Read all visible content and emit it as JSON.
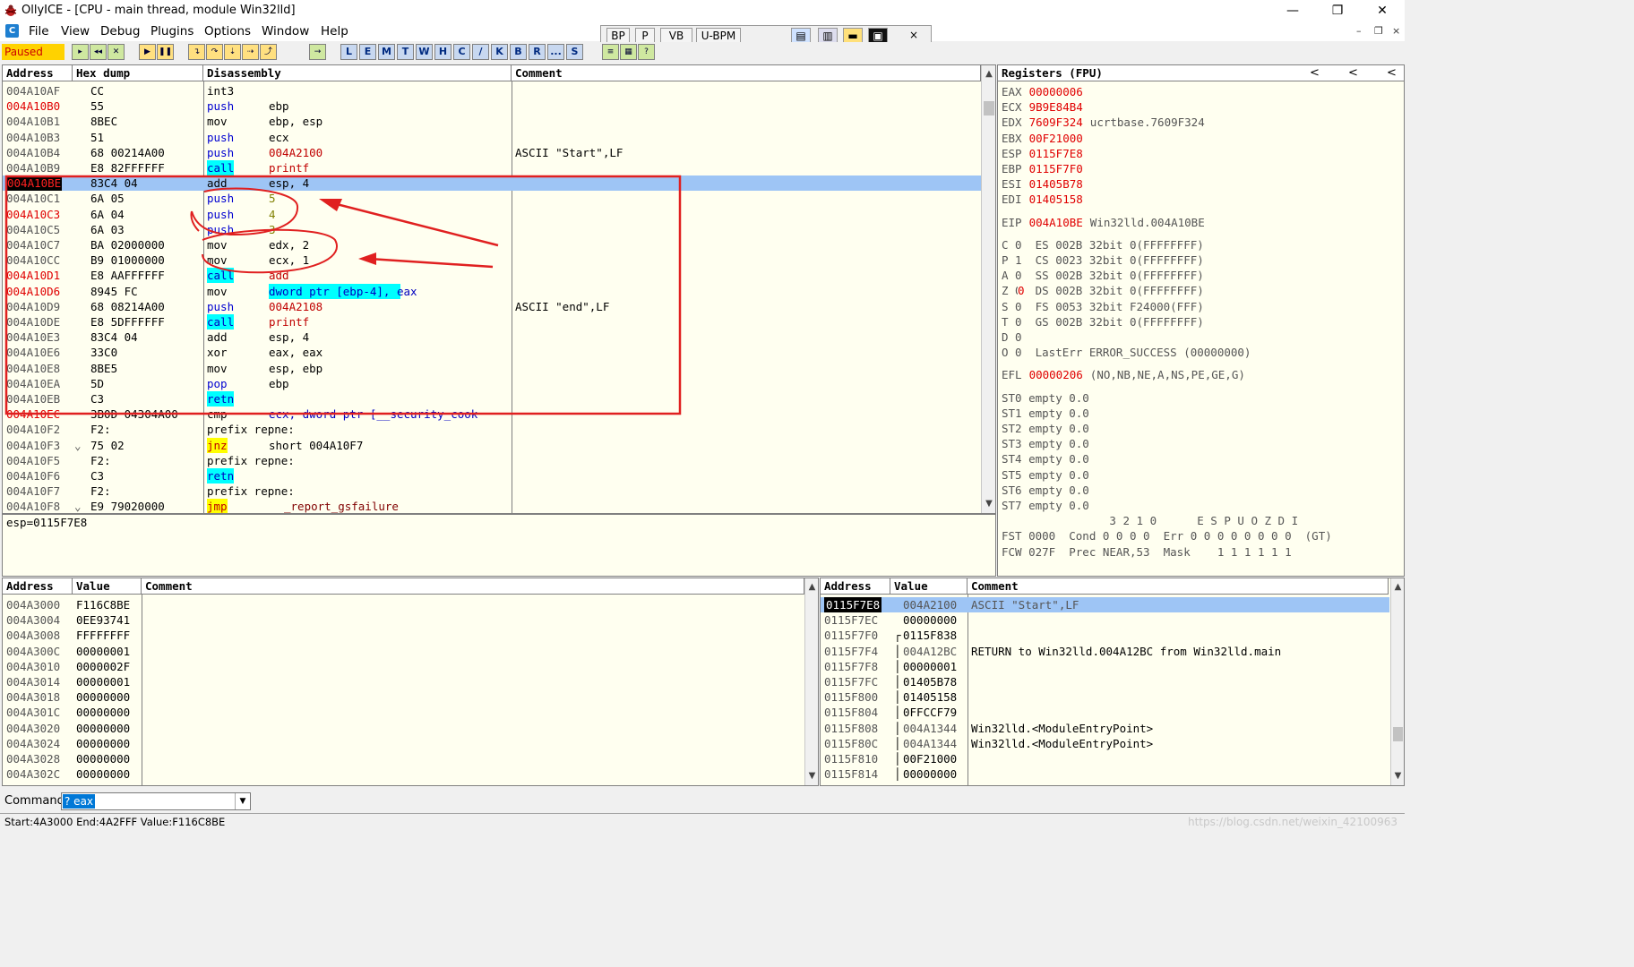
{
  "window": {
    "title": "OllyICE - [CPU - main thread, module Win32lld]",
    "minimize": "—",
    "restore": "❐",
    "close": "✕"
  },
  "menu": [
    "File",
    "View",
    "Debug",
    "Plugins",
    "Options",
    "Window",
    "Help"
  ],
  "mdi_controls": [
    "–",
    "❐",
    "×"
  ],
  "tb2": [
    "BP",
    "P",
    "VB",
    "U-BPM",
    "×"
  ],
  "toolbar": {
    "status": "Paused",
    "letters": [
      "L",
      "E",
      "M",
      "T",
      "W",
      "H",
      "C",
      "/",
      "K",
      "B",
      "R",
      "...",
      "S"
    ]
  },
  "cpu": {
    "headers": {
      "address": "Address",
      "hex": "Hex dump",
      "disasm": "Disassembly",
      "comment": "Comment"
    },
    "rows": [
      {
        "addr": "004A10AF",
        "hex": "CC",
        "mn": "int3",
        "op": "",
        "cm": ""
      },
      {
        "addr": "004A10B0",
        "hex": "55",
        "mn": "push",
        "op": "ebp",
        "cm": ""
      },
      {
        "addr": "004A10B1",
        "hex": "8BEC",
        "mn": "mov",
        "op": "ebp, esp",
        "cm": ""
      },
      {
        "addr": "004A10B3",
        "hex": "51",
        "mn": "push",
        "op": "ecx",
        "cm": ""
      },
      {
        "addr": "004A10B4",
        "hex": "68 00214A00",
        "mn": "push",
        "op": "004A2100",
        "cm": "ASCII \"Start\",LF"
      },
      {
        "addr": "004A10B9",
        "hex": "E8 82FFFFFF",
        "mn": "call",
        "op": "printf",
        "cm": ""
      },
      {
        "addr": "004A10BE",
        "hex": "83C4 04",
        "mn": "add",
        "op": "esp, 4",
        "cm": ""
      },
      {
        "addr": "004A10C1",
        "hex": "6A 05",
        "mn": "push",
        "op": "5",
        "cm": ""
      },
      {
        "addr": "004A10C3",
        "hex": "6A 04",
        "mn": "push",
        "op": "4",
        "cm": ""
      },
      {
        "addr": "004A10C5",
        "hex": "6A 03",
        "mn": "push",
        "op": "3",
        "cm": ""
      },
      {
        "addr": "004A10C7",
        "hex": "BA 02000000",
        "mn": "mov",
        "op": "edx, 2",
        "cm": ""
      },
      {
        "addr": "004A10CC",
        "hex": "B9 01000000",
        "mn": "mov",
        "op": "ecx, 1",
        "cm": ""
      },
      {
        "addr": "004A10D1",
        "hex": "E8 AAFFFFFF",
        "mn": "call",
        "op": "add",
        "cm": ""
      },
      {
        "addr": "004A10D6",
        "hex": "8945 FC",
        "mn": "mov",
        "op": "dword ptr [ebp-4], eax",
        "cm": ""
      },
      {
        "addr": "004A10D9",
        "hex": "68 08214A00",
        "mn": "push",
        "op": "004A2108",
        "cm": "ASCII \"end\",LF"
      },
      {
        "addr": "004A10DE",
        "hex": "E8 5DFFFFFF",
        "mn": "call",
        "op": "printf",
        "cm": ""
      },
      {
        "addr": "004A10E3",
        "hex": "83C4 04",
        "mn": "add",
        "op": "esp, 4",
        "cm": ""
      },
      {
        "addr": "004A10E6",
        "hex": "33C0",
        "mn": "xor",
        "op": "eax, eax",
        "cm": ""
      },
      {
        "addr": "004A10E8",
        "hex": "8BE5",
        "mn": "mov",
        "op": "esp, ebp",
        "cm": ""
      },
      {
        "addr": "004A10EA",
        "hex": "5D",
        "mn": "pop",
        "op": "ebp",
        "cm": ""
      },
      {
        "addr": "004A10EB",
        "hex": "C3",
        "mn": "retn",
        "op": "",
        "cm": ""
      },
      {
        "addr": "004A10EC",
        "hex": "3B0D 04304A00",
        "mn": "cmp",
        "op": "ecx, dword ptr [__security_cook",
        "cm": ""
      },
      {
        "addr": "004A10F2",
        "hex": "F2:",
        "mn": "prefix repne:",
        "op": "",
        "cm": ""
      },
      {
        "addr": "004A10F3",
        "hex": "75 02",
        "mn": "jnz",
        "op": "short 004A10F7",
        "cm": ""
      },
      {
        "addr": "004A10F5",
        "hex": "F2:",
        "mn": "prefix repne:",
        "op": "",
        "cm": ""
      },
      {
        "addr": "004A10F6",
        "hex": "C3",
        "mn": "retn",
        "op": "",
        "cm": ""
      },
      {
        "addr": "004A10F7",
        "hex": "F2:",
        "mn": "prefix repne:",
        "op": "",
        "cm": ""
      },
      {
        "addr": "004A10F8",
        "hex": "E9 79020000",
        "mn": "jmp",
        "op": "_report_gsfailure",
        "cm": ""
      }
    ]
  },
  "info_line": "esp=0115F7E8",
  "registers": {
    "header": "Registers (FPU)",
    "gp": [
      {
        "name": "EAX",
        "val": "00000006",
        "desc": ""
      },
      {
        "name": "ECX",
        "val": "9B9E84B4",
        "desc": ""
      },
      {
        "name": "EDX",
        "val": "7609F324",
        "desc": "ucrtbase.7609F324"
      },
      {
        "name": "EBX",
        "val": "00F21000",
        "desc": ""
      },
      {
        "name": "ESP",
        "val": "0115F7E8",
        "desc": ""
      },
      {
        "name": "EBP",
        "val": "0115F7F0",
        "desc": ""
      },
      {
        "name": "ESI",
        "val": "01405B78",
        "desc": ""
      },
      {
        "name": "EDI",
        "val": "01405158",
        "desc": ""
      }
    ],
    "eip": {
      "name": "EIP",
      "val": "004A10BE",
      "desc": "Win32lld.004A10BE"
    },
    "flags": [
      "C 0  ES 002B 32bit 0(FFFFFFFF)",
      "P 1  CS 0023 32bit 0(FFFFFFFF)",
      "A 0  SS 002B 32bit 0(FFFFFFFF)",
      "Z 0  DS 002B 32bit 0(FFFFFFFF)",
      "S 0  FS 0053 32bit F24000(FFF)",
      "T 0  GS 002B 32bit 0(FFFFFFFF)",
      "D 0",
      "O 0  LastErr ERROR_SUCCESS (00000000)"
    ],
    "efl": {
      "name": "EFL",
      "val": "00000206",
      "desc": "(NO,NB,NE,A,NS,PE,GE,G)"
    },
    "st": [
      "ST0 empty 0.0",
      "ST1 empty 0.0",
      "ST2 empty 0.0",
      "ST3 empty 0.0",
      "ST4 empty 0.0",
      "ST5 empty 0.0",
      "ST6 empty 0.0",
      "ST7 empty 0.0"
    ],
    "fpu": [
      "                3 2 1 0      E S P U O Z D I",
      "FST 0000  Cond 0 0 0 0  Err 0 0 0 0 0 0 0 0  (GT)",
      "FCW 027F  Prec NEAR,53  Mask    1 1 1 1 1 1"
    ],
    "nav": [
      "<",
      "<",
      "<"
    ]
  },
  "dump": {
    "headers": {
      "address": "Address",
      "value": "Value",
      "comment": "Comment"
    },
    "rows": [
      {
        "addr": "004A3000",
        "val": "F116C8BE"
      },
      {
        "addr": "004A3004",
        "val": "0EE93741"
      },
      {
        "addr": "004A3008",
        "val": "FFFFFFFF"
      },
      {
        "addr": "004A300C",
        "val": "00000001"
      },
      {
        "addr": "004A3010",
        "val": "0000002F"
      },
      {
        "addr": "004A3014",
        "val": "00000001"
      },
      {
        "addr": "004A3018",
        "val": "00000000"
      },
      {
        "addr": "004A301C",
        "val": "00000000"
      },
      {
        "addr": "004A3020",
        "val": "00000000"
      },
      {
        "addr": "004A3024",
        "val": "00000000"
      },
      {
        "addr": "004A3028",
        "val": "00000000"
      },
      {
        "addr": "004A302C",
        "val": "00000000"
      }
    ]
  },
  "stack": {
    "headers": {
      "address": "Address",
      "value": "Value",
      "comment": "Comment"
    },
    "rows": [
      {
        "addr": "0115F7E8",
        "val": "004A2100",
        "cm": "ASCII \"Start\",LF"
      },
      {
        "addr": "0115F7EC",
        "val": "00000000",
        "cm": ""
      },
      {
        "addr": "0115F7F0",
        "val": "0115F838",
        "cm": ""
      },
      {
        "addr": "0115F7F4",
        "val": "004A12BC",
        "cm": "RETURN to Win32lld.004A12BC from Win32lld.main"
      },
      {
        "addr": "0115F7F8",
        "val": "00000001",
        "cm": ""
      },
      {
        "addr": "0115F7FC",
        "val": "01405B78",
        "cm": ""
      },
      {
        "addr": "0115F800",
        "val": "01405158",
        "cm": ""
      },
      {
        "addr": "0115F804",
        "val": "0FFCCF79",
        "cm": ""
      },
      {
        "addr": "0115F808",
        "val": "004A1344",
        "cm": "Win32lld.<ModuleEntryPoint>"
      },
      {
        "addr": "0115F80C",
        "val": "004A1344",
        "cm": "Win32lld.<ModuleEntryPoint>"
      },
      {
        "addr": "0115F810",
        "val": "00F21000",
        "cm": ""
      },
      {
        "addr": "0115F814",
        "val": "00000000",
        "cm": ""
      }
    ]
  },
  "command": {
    "label": "Command",
    "value": "? eax"
  },
  "status": "Start:4A3000 End:4A2FFF Value:F116C8BE",
  "watermark": "https://blog.csdn.net/weixin_42100963"
}
